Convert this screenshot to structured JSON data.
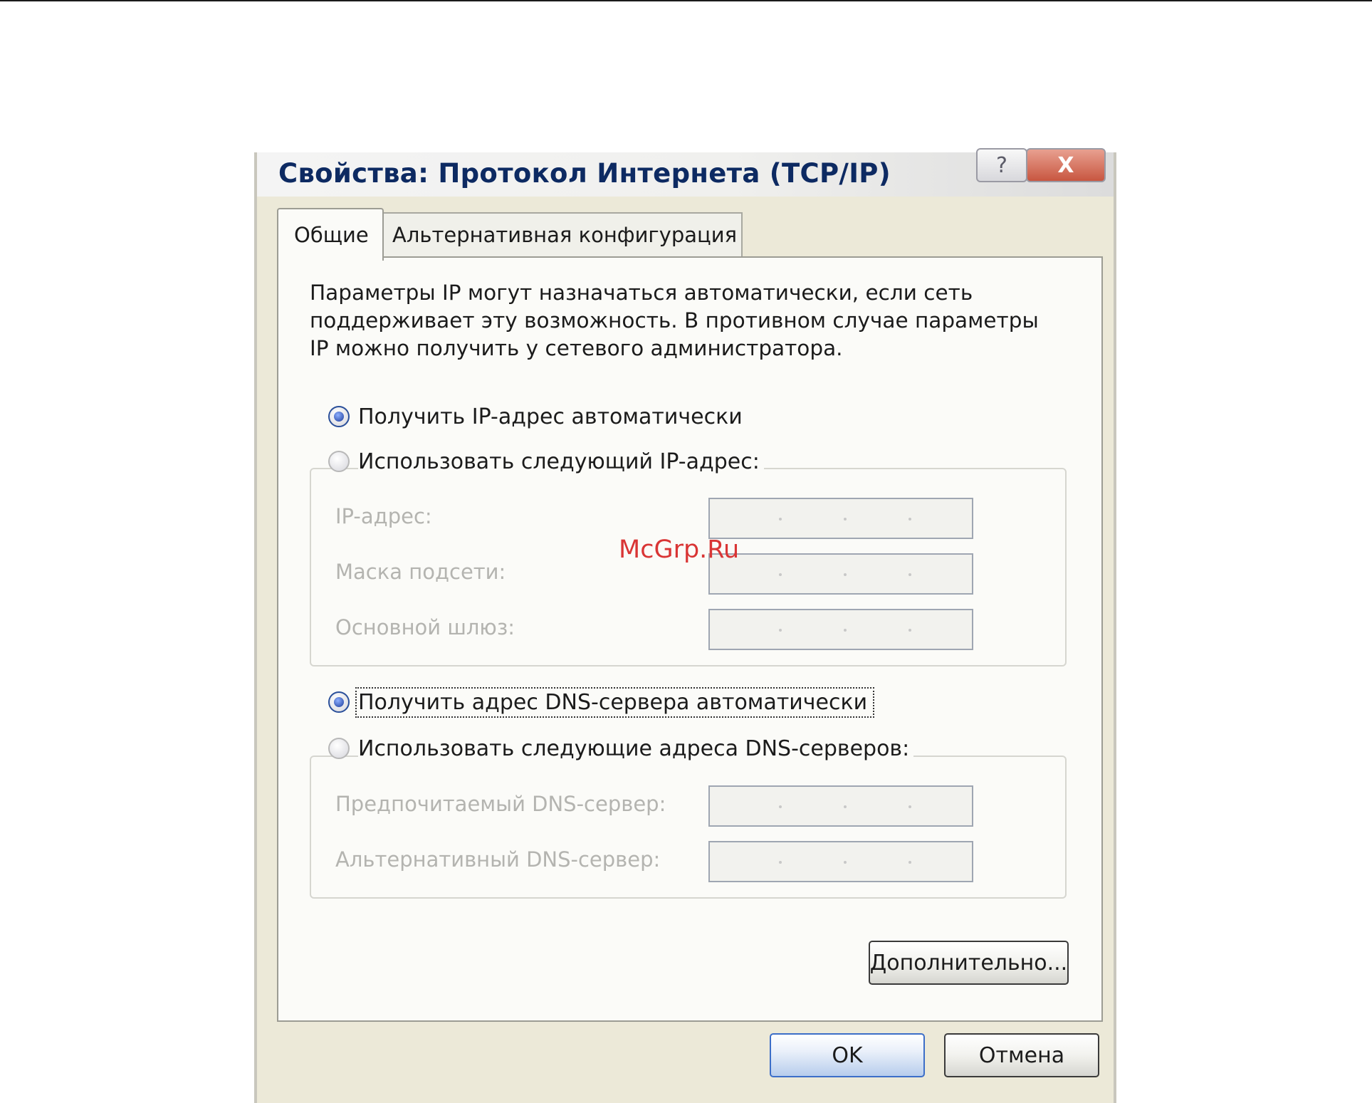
{
  "dialog": {
    "title": "Свойства: Протокол Интернета (TCP/IP)",
    "help_button": "?",
    "close_button": "X"
  },
  "tabs": [
    {
      "label": "Общие",
      "active": true
    },
    {
      "label": "Альтернативная конфигурация",
      "active": false
    }
  ],
  "description": "Параметры IP могут назначаться автоматически, если сеть поддерживает эту возможность. В противном случае параметры IP можно получить у сетевого администратора.",
  "ip_section": {
    "auto_radio": {
      "label": "Получить IP-адрес автоматически",
      "selected": true
    },
    "manual_radio": {
      "label": "Использовать следующий IP-адрес:",
      "selected": false
    },
    "fields": [
      {
        "label": "IP-адрес:",
        "value": ". . ."
      },
      {
        "label": "Маска подсети:",
        "value": ". . ."
      },
      {
        "label": "Основной шлюз:",
        "value": ". . ."
      }
    ]
  },
  "dns_section": {
    "auto_radio": {
      "label": "Получить адрес DNS-сервера автоматически",
      "selected": true
    },
    "manual_radio": {
      "label": "Использовать следующие адреса DNS-серверов:",
      "selected": false
    },
    "fields": [
      {
        "label": "Предпочитаемый DNS-сервер:",
        "value": ". . ."
      },
      {
        "label": "Альтернативный DNS-сервер:",
        "value": ". . ."
      }
    ]
  },
  "buttons": {
    "advanced": "Дополнительно...",
    "ok": "OK",
    "cancel": "Отмена"
  },
  "watermark": "McGrp.Ru",
  "colors": {
    "title_text": "#0d2a62",
    "dialog_bg": "#ece9d8",
    "panel_bg": "#fbfbf8",
    "disabled_text": "#b4b4b0",
    "watermark": "#d93535"
  }
}
